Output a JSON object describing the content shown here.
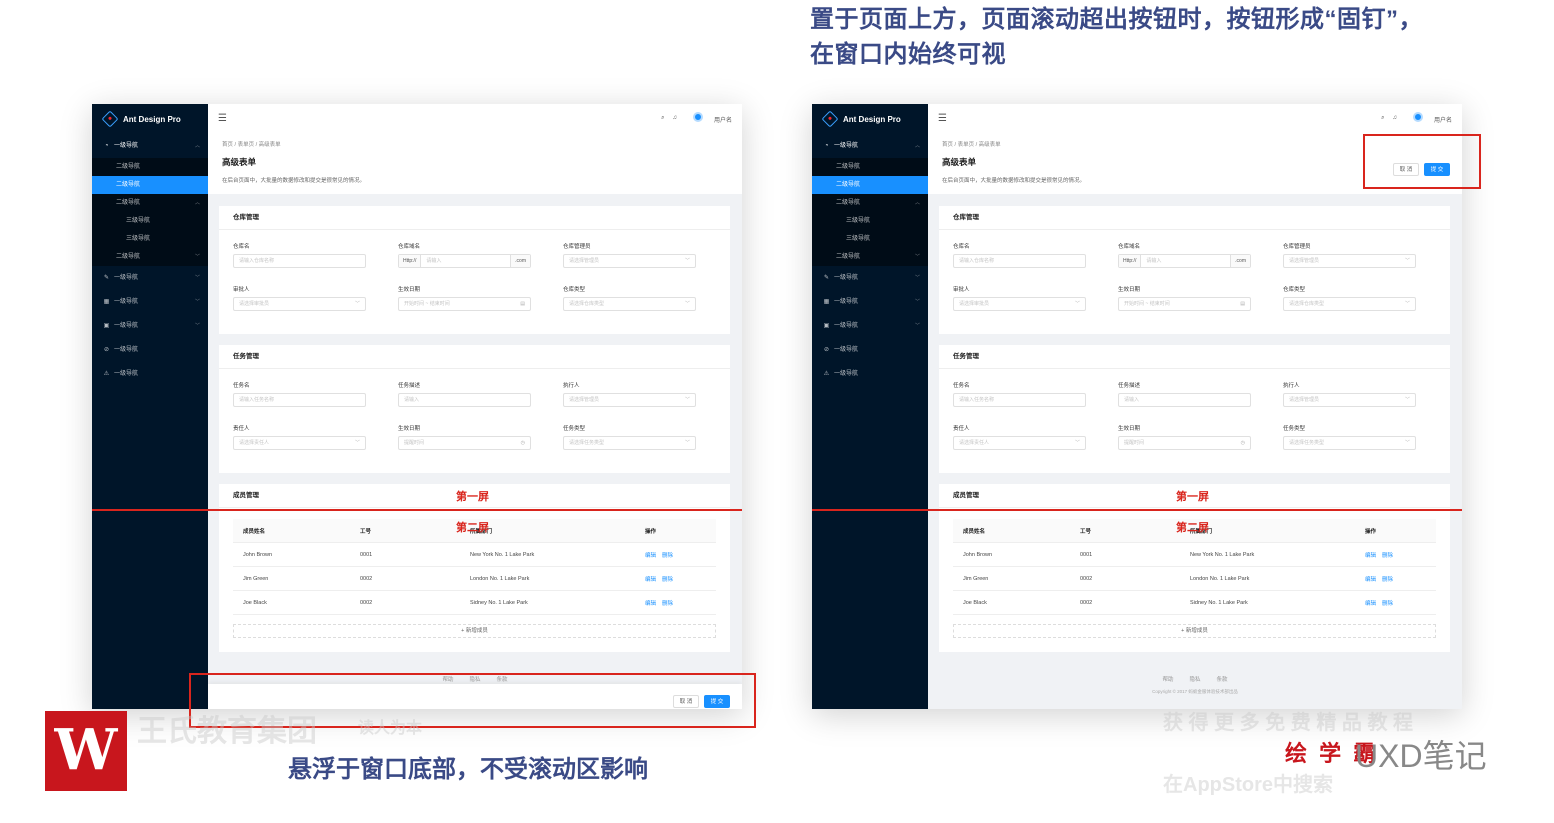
{
  "annotations": {
    "top_line1": "置于页面上方，页面滚动超出按钮时，按钮形成“固钉”，",
    "top_line2": "在窗口内始终可视",
    "bottom": "悬浮于窗口底部，不受滚动区影响",
    "screen1": "第一屏",
    "screen2": "第二屏",
    "accent_color": "#d9251d"
  },
  "app": {
    "logo_text": "Ant Design Pro",
    "user_name": "用户名",
    "primary_color": "#1890ff",
    "sider_color": "#001529"
  },
  "menu": {
    "l1_open": "一级导航",
    "l2a": "二级导航",
    "l2b_selected": "二级导航",
    "l2c": "二级导航",
    "l3a": "三级导航",
    "l3b": "三级导航",
    "l2d": "二级导航",
    "l1_items": [
      {
        "label": "一级导航",
        "icon": "edit-icon"
      },
      {
        "label": "一级导航",
        "icon": "table-icon"
      },
      {
        "label": "一级导航",
        "icon": "profile-icon"
      },
      {
        "label": "一级导航",
        "icon": "check-circle-icon"
      },
      {
        "label": "一级导航",
        "icon": "warning-icon"
      }
    ]
  },
  "page": {
    "breadcrumb": "首页 / 表单页 / 高级表单",
    "title": "高级表单",
    "description": "在后台页面中，大批量的数据修改和提交是很常见的情况。"
  },
  "warehouse": {
    "title": "仓库管理",
    "name_label": "仓库名",
    "name_ph": "请输入仓库名称",
    "domain_label": "仓库域名",
    "domain_prefix": "Http://",
    "domain_ph": "请输入",
    "domain_suffix": ".com",
    "admin_label": "仓库管理员",
    "admin_ph": "请选择管理员",
    "approver_label": "审批人",
    "approver_ph": "请选择审批员",
    "date_label": "生效日期",
    "date_ph": "开始时间 ~ 结束时间",
    "type_label": "仓库类型",
    "type_ph": "请选择仓库类型"
  },
  "task": {
    "title": "任务管理",
    "name_label": "任务名",
    "name_ph": "请输入任务名称",
    "desc_label": "任务描述",
    "desc_ph": "请输入",
    "exec_label": "执行人",
    "exec_ph": "请选择管理员",
    "owner_label": "责任人",
    "owner_ph": "请选择责任人",
    "date_label": "生效日期",
    "date_ph": "提醒时间",
    "type_label": "任务类型",
    "type_ph": "请选择任务类型"
  },
  "members": {
    "title": "成员管理",
    "columns": [
      "成员姓名",
      "工号",
      "所属部门",
      "操作"
    ],
    "rows": [
      {
        "name": "John Brown",
        "id": "0001",
        "dept": "New York No. 1 Lake Park"
      },
      {
        "name": "Jim Green",
        "id": "0002",
        "dept": "London No. 1 Lake Park"
      },
      {
        "name": "Joe Black",
        "id": "0002",
        "dept": "Sidney No. 1 Lake Park"
      }
    ],
    "edit": "编辑",
    "delete": "删除",
    "add": "+ 新增成员"
  },
  "footer": {
    "help": "帮助",
    "privacy": "隐私",
    "terms": "条款",
    "copyright": "Copyright © 2017 蚂蚁金服体验技术部出品"
  },
  "actions": {
    "cancel": "取 消",
    "submit": "提 交"
  },
  "watermark": {
    "badge": "W",
    "org": "王氏教育集团",
    "slogan": "读人为本",
    "right1": "获 得 更 多 免 费 精 品 教 程",
    "right2": "在AppStore中搜索",
    "brand": "绘 学 霸",
    "brand2": "UXD笔记"
  }
}
